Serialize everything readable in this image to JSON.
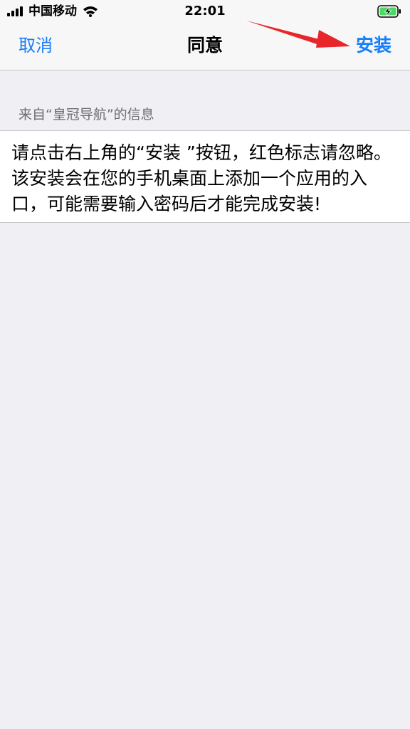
{
  "status_bar": {
    "carrier": "中国移动",
    "time": "22:01",
    "icons": [
      "signal-icon",
      "wifi-icon",
      "battery-charging-icon"
    ]
  },
  "nav": {
    "cancel_label": "取消",
    "title": "同意",
    "install_label": "安装"
  },
  "section": {
    "header": "来自“皇冠导航”的信息",
    "message": "请点击右上角的“安装 ”按钮，红色标志请忽略。该安装会在您的手机桌面上添加一个应用的入口，可能需要输入密码后才能完成安装!"
  },
  "colors": {
    "accent": "#157efb",
    "annotation_arrow": "#e8262a",
    "background": "#efeff4",
    "battery": "#4cd964"
  }
}
